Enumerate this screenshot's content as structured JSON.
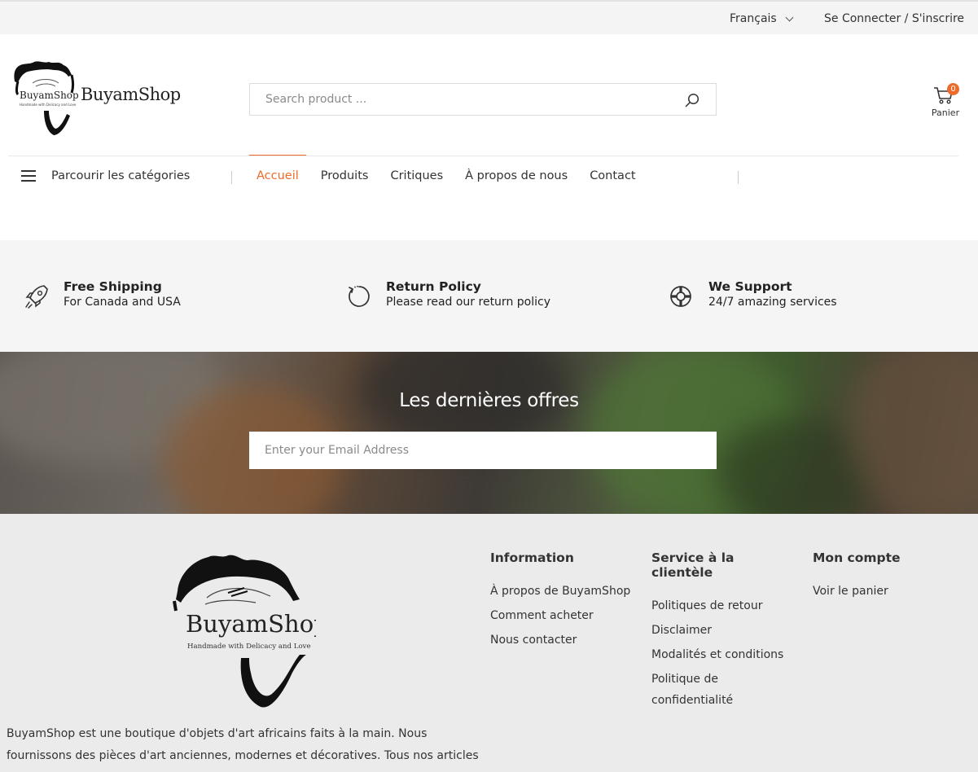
{
  "topbar": {
    "language": "Français",
    "login": "Se Connecter / S'inscrire"
  },
  "header": {
    "brand": "BuyamShop",
    "search_placeholder": "Search product ...",
    "cart_count": "0",
    "cart_label": "Panier"
  },
  "nav": {
    "browse_label": "Parcourir les catégories",
    "items": [
      "Accueil",
      "Produits",
      "Critiques",
      "À propos de nous",
      "Contact"
    ],
    "active_index": 0
  },
  "features": [
    {
      "icon": "rocket-icon",
      "title": "Free Shipping",
      "subtitle": "For Canada and USA"
    },
    {
      "icon": "return-arrow-icon",
      "title": "Return Policy",
      "subtitle": "Please read our return policy"
    },
    {
      "icon": "lifebuoy-icon",
      "title": "We Support",
      "subtitle": "24/7 amazing services"
    }
  ],
  "newsletter": {
    "title": "Les dernières offres",
    "placeholder": "Enter your Email Address"
  },
  "footer": {
    "description": "BuyamShop est une boutique d'objets d'art africains faits à la main. Nous fournissons des pièces d'art anciennes, modernes et décoratives. Tous nos articles",
    "columns": [
      {
        "title": "Information",
        "links": [
          "À propos de BuyamShop",
          "Comment acheter",
          "Nous contacter"
        ]
      },
      {
        "title": "Service à la clientèle",
        "links": [
          "Politiques de retour",
          "Disclaimer",
          "Modalités et conditions",
          "Politique de confidentialité"
        ]
      },
      {
        "title": "Mon compte",
        "links": [
          "Voir le panier"
        ]
      }
    ]
  },
  "colors": {
    "accent": "#ee6a2a",
    "footer_bg": "#ebebeb",
    "features_bg": "#f5f5f5"
  }
}
